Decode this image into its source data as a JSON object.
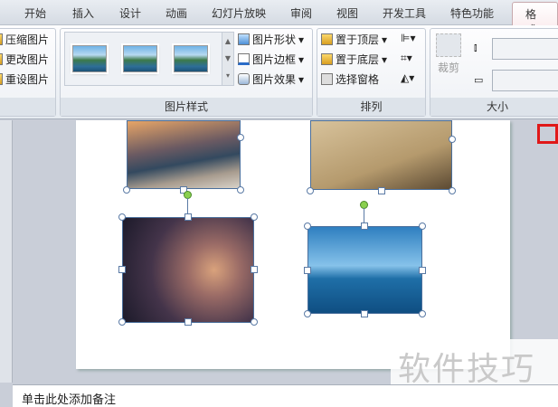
{
  "tabs": [
    "开始",
    "插入",
    "设计",
    "动画",
    "幻灯片放映",
    "审阅",
    "视图",
    "开发工具",
    "特色功能",
    "格式"
  ],
  "adjust": {
    "items": [
      "压缩图片",
      "更改图片",
      "重设图片"
    ]
  },
  "picture_styles": {
    "label": "图片样式",
    "items": [
      "图片形状",
      "图片边框",
      "图片效果"
    ]
  },
  "arrange": {
    "label": "排列",
    "items": [
      "置于顶层",
      "置于底层",
      "选择窗格"
    ]
  },
  "size": {
    "label": "大小",
    "crop": "裁剪",
    "height": "",
    "width": ""
  },
  "notes": {
    "placeholder": "单击此处添加备注"
  },
  "watermark": "软件技巧"
}
